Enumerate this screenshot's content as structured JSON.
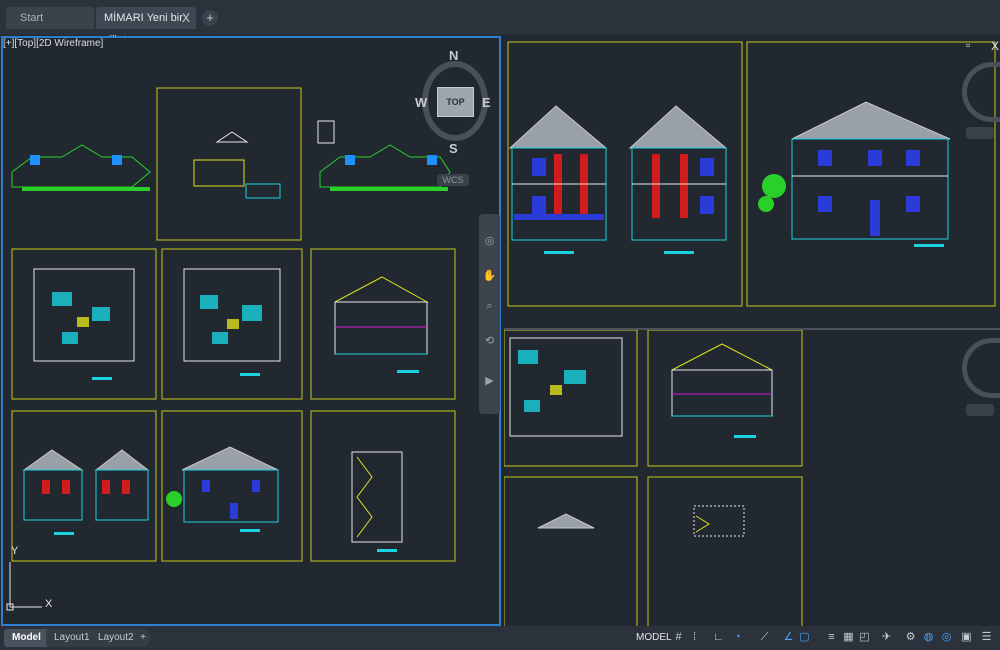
{
  "tabs": {
    "start_label": "Start",
    "active_label": "MİMARI Yeni bir villa*",
    "close_glyph": "X",
    "new_tab_glyph": "+"
  },
  "viewport": {
    "label": "[+][Top][2D Wireframe]",
    "compass": {
      "north": "N",
      "south": "S",
      "east": "E",
      "west": "W",
      "top_face": "TOP"
    },
    "wcs": "WCS",
    "ucs_y": "Y",
    "ucs_x": "X",
    "restore_glyph": "▫",
    "close_glyph": "X"
  },
  "layout_tabs": {
    "model": "Model",
    "layout1": "Layout1",
    "layout2": "Layout2",
    "add": "+"
  },
  "status_bar": {
    "model_label": "MODEL",
    "icons": [
      "grid-icon",
      "snap-icon",
      "ortho-icon",
      "polar-icon",
      "isodraft-icon",
      "osnap-icon",
      "otrack-icon",
      "lineweight-icon",
      "transparency-icon",
      "selection-cycling-icon",
      "annotation-scale-icon",
      "workspace-icon",
      "isolate-icon",
      "hardware-accel-icon",
      "clean-screen-icon",
      "customize-icon"
    ]
  },
  "colors": {
    "background": "#212830",
    "sheet_border": "#c8c81a",
    "active_viewport": "#2f7fd0",
    "drawing_cyan": "#19d3e0",
    "drawing_red": "#d01c1c",
    "drawing_magenta": "#d01cd0",
    "drawing_yellow": "#e0e01c",
    "drawing_blue": "#2a3bd8",
    "drawing_green": "#2ad02a",
    "drawing_white": "#e6e6e6"
  }
}
